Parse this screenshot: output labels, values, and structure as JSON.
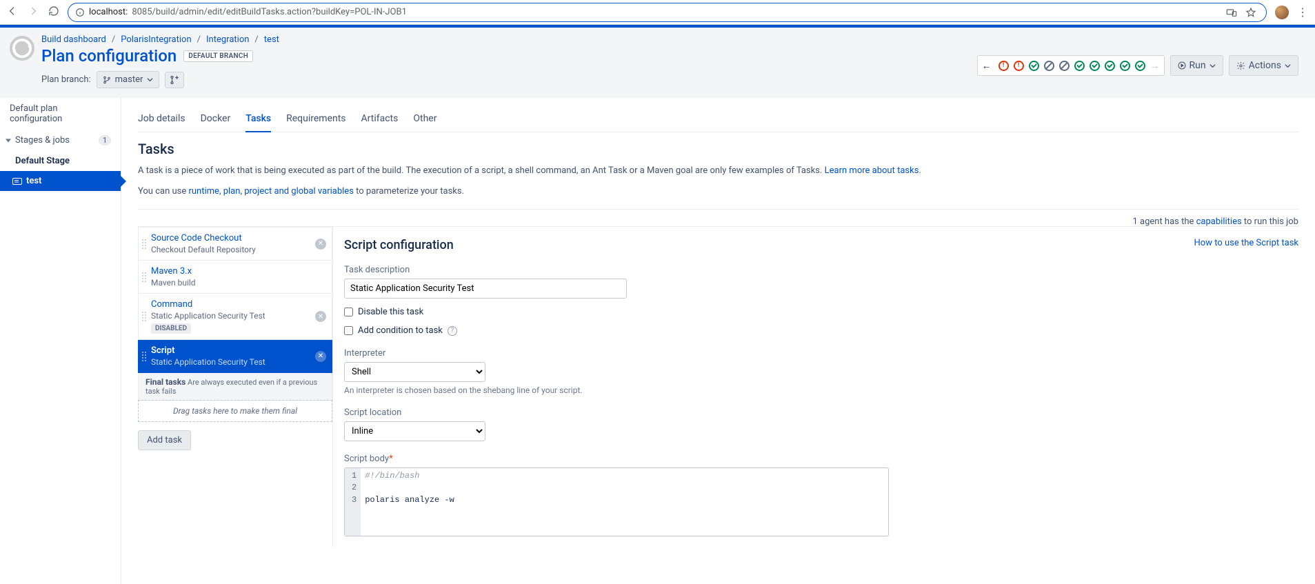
{
  "browser": {
    "url_host": "localhost:",
    "url_path": "8085/build/admin/edit/editBuildTasks.action?buildKey=POL-IN-JOB1"
  },
  "breadcrumb": [
    "Build dashboard",
    "PolarisIntegration",
    "Integration",
    "test"
  ],
  "header": {
    "title": "Plan configuration",
    "branch_badge": "DEFAULT BRANCH",
    "plan_branch_label": "Plan branch:",
    "branch_selected": "master",
    "run_label": "Run",
    "actions_label": "Actions",
    "status_icons": [
      "back",
      "fail",
      "fail",
      "pass",
      "skip",
      "skip",
      "pass",
      "pass",
      "pass",
      "pass",
      "pass"
    ]
  },
  "sidebar": {
    "items": [
      {
        "label": "Default plan configuration"
      },
      {
        "label": "Stages & jobs",
        "badge": "1"
      }
    ],
    "stage": "Default Stage",
    "job": "test"
  },
  "tabs": [
    "Job details",
    "Docker",
    "Tasks",
    "Requirements",
    "Artifacts",
    "Other"
  ],
  "tabs_active": 2,
  "tasks_section": {
    "title": "Tasks",
    "desc_pre": "A task is a piece of work that is being executed as part of the build. The execution of a script, a shell command, an Ant Task or a Maven goal are only few examples of Tasks. ",
    "desc_link": "Learn more about tasks.",
    "vars_pre": "You can use ",
    "vars_link": "runtime, plan, project and global variables",
    "vars_post": " to parameterize your tasks.",
    "agent_pre": "1 agent has the ",
    "agent_link": "capabilities",
    "agent_post": " to run this job"
  },
  "task_list": [
    {
      "title": "Source Code Checkout",
      "sub": "Checkout Default Repository",
      "disabled": false,
      "selected": false,
      "deletable": true
    },
    {
      "title": "Maven 3.x",
      "sub": "Maven build",
      "disabled": false,
      "selected": false,
      "deletable": false
    },
    {
      "title": "Command",
      "sub": "Static Application Security Test",
      "disabled": true,
      "selected": false,
      "deletable": true
    },
    {
      "title": "Script",
      "sub": "Static Application Security Test",
      "disabled": false,
      "selected": true,
      "deletable": true
    }
  ],
  "task_list_footer": {
    "final_label": "Final tasks",
    "final_hint": "Are always executed even if a previous task fails",
    "drop_hint": "Drag tasks here to make them final",
    "add_task": "Add task",
    "disabled_tag": "DISABLED"
  },
  "form": {
    "title": "Script configuration",
    "help_link": "How to use the Script task",
    "task_desc_label": "Task description",
    "task_desc_value": "Static Application Security Test",
    "disable_label": "Disable this task",
    "condition_label": "Add condition to task",
    "interpreter_label": "Interpreter",
    "interpreter_value": "Shell",
    "interpreter_hint": "An interpreter is chosen based on the shebang line of your script.",
    "location_label": "Script location",
    "location_value": "Inline",
    "body_label": "Script body",
    "code_lines": [
      "#!/bin/bash",
      "",
      "polaris analyze -w"
    ]
  }
}
